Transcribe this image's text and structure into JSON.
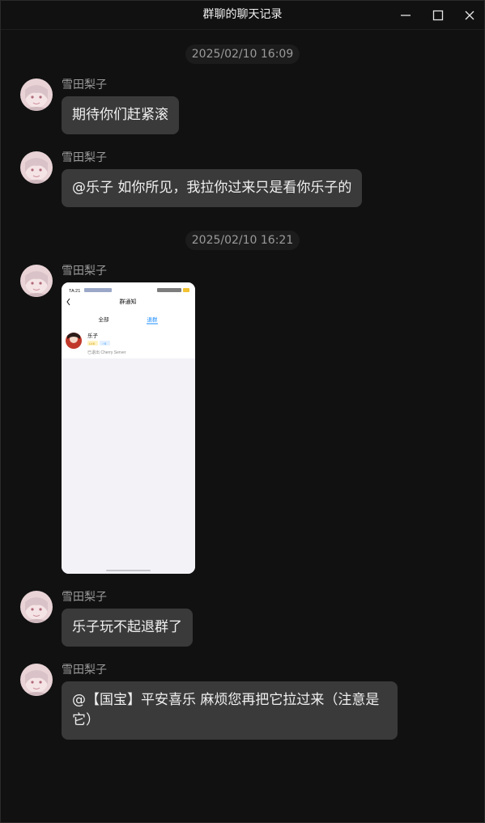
{
  "window": {
    "title": "群聊的聊天记录",
    "controls": [
      "minimize-icon",
      "maximize-icon",
      "close-icon"
    ]
  },
  "messages": [
    {
      "type": "timestamp",
      "text": "2025/02/10 16:09"
    },
    {
      "type": "text",
      "sender": "雪田梨子",
      "text": "期待你们赶紧滚"
    },
    {
      "type": "text",
      "sender": "雪田梨子",
      "text": "@乐子 如你所见，我拉你过来只是看你乐子的"
    },
    {
      "type": "timestamp",
      "text": "2025/02/10 16:21"
    },
    {
      "type": "image",
      "sender": "雪田梨子",
      "screenshot": {
        "status_time": "TA:21",
        "header_title": "群通知",
        "tab_all": "全部",
        "tab_quit": "退群",
        "member_name": "乐子",
        "member_tag_1": "LV8",
        "member_tag_2": "♂0",
        "member_status": "已退出 Cherry Server"
      }
    },
    {
      "type": "text",
      "sender": "雪田梨子",
      "text": "乐子玩不起退群了"
    },
    {
      "type": "text",
      "sender": "雪田梨子",
      "text": "@【国宝】平安喜乐  麻烦您再把它拉过来（注意是它）"
    }
  ],
  "colors": {
    "background": "#111111",
    "bubble": "#3a3a3a",
    "sender": "#9a9a9a",
    "text": "#f0f0f0",
    "timestamp_bg": "#1c1c1c",
    "accent_tab": "#1a8cff"
  }
}
